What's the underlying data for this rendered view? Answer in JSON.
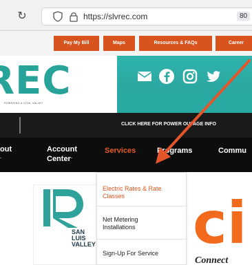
{
  "browser": {
    "url": "https://slvrec.com",
    "zoom_label": "80"
  },
  "topbar": {
    "buttons": [
      "Pay My Bill",
      "Maps",
      "Resources & FAQs",
      "Career"
    ]
  },
  "logo": {
    "text": "REC",
    "tagline": "POWERING A VITAL VALLEY"
  },
  "social": [
    "email-icon",
    "facebook-icon",
    "instagram-icon",
    "twitter-icon"
  ],
  "outage": {
    "text": "CLICK HERE FOR POWER OUTAGE INFO"
  },
  "nav": {
    "items": [
      {
        "label": "out",
        "caret": "ˇ"
      },
      {
        "label_line1": "Account",
        "label_line2": "Center"
      },
      {
        "label": "Services",
        "active": true
      },
      {
        "label": "Programs"
      },
      {
        "label": "Commu"
      }
    ]
  },
  "dropdown": {
    "items": [
      {
        "line1": "Electric Rates & Rate",
        "line2": "Classes"
      },
      {
        "line1": "Net Metering",
        "line2": "Installations"
      },
      {
        "line1": "Sign-Up For Service"
      }
    ]
  },
  "hero": {
    "org_lines": [
      "SAN",
      "LUIS",
      "VALLEY"
    ],
    "promo_letters": "ci",
    "promo_text": "Connect"
  },
  "colors": {
    "accent_orange": "#d9531e",
    "teal": "#27a39a",
    "nav_bg": "#0d0d0d",
    "arrow": "#e5552b"
  }
}
